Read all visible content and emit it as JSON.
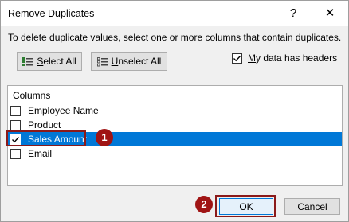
{
  "dialog": {
    "title": "Remove Duplicates",
    "help_label": "?",
    "close_label": "✕",
    "instructions": "To delete duplicate values, select one or more columns that contain duplicates."
  },
  "toolbar": {
    "select_all_accel": "S",
    "select_all_rest": "elect All",
    "unselect_all_accel": "U",
    "unselect_all_rest": "nselect All"
  },
  "headers_option": {
    "accel": "M",
    "rest": "y data has headers",
    "checked": true
  },
  "columns": {
    "header": "Columns",
    "items": [
      {
        "label": "Employee Name",
        "checked": false,
        "selected": false
      },
      {
        "label": "Product",
        "checked": false,
        "selected": false
      },
      {
        "label": "Sales Amount",
        "checked": true,
        "selected": true
      },
      {
        "label": "Email",
        "checked": false,
        "selected": false
      }
    ]
  },
  "annotations": {
    "badge_1": "1",
    "badge_2": "2",
    "badge_color": "#a01414",
    "highlight_color": "#8b1a1a"
  },
  "buttons": {
    "ok_label": "OK",
    "cancel_label": "Cancel"
  },
  "colors": {
    "selection": "#0078d7",
    "dialog_bg": "#f0f0f0"
  }
}
